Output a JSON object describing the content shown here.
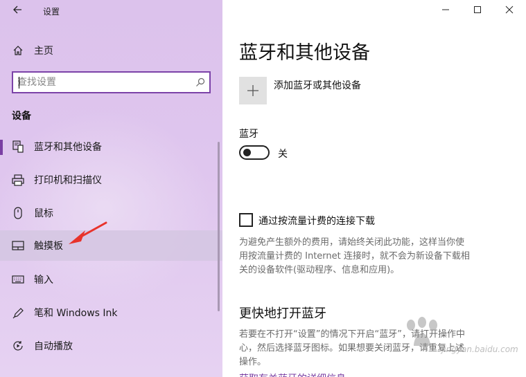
{
  "window": {
    "app_title": "设置",
    "controls": {
      "minimize": "—",
      "maximize": "☐",
      "close": "✕"
    }
  },
  "nav": {
    "home_label": "主页",
    "search_placeholder": "查找设置",
    "section_title": "设备",
    "items": [
      {
        "label": "蓝牙和其他设备",
        "icon": "bluetooth-device-icon",
        "active": true
      },
      {
        "label": "打印机和扫描仪",
        "icon": "printer-icon"
      },
      {
        "label": "鼠标",
        "icon": "mouse-icon"
      },
      {
        "label": "触摸板",
        "icon": "touchpad-icon",
        "hover": true
      },
      {
        "label": "输入",
        "icon": "keyboard-icon"
      },
      {
        "label": "笔和 Windows Ink",
        "icon": "pen-icon"
      },
      {
        "label": "自动播放",
        "icon": "autoplay-icon"
      }
    ]
  },
  "content": {
    "title": "蓝牙和其他设备",
    "add_device_label": "添加蓝牙或其他设备",
    "bluetooth": {
      "heading": "蓝牙",
      "state_label": "关",
      "on": false
    },
    "metered": {
      "label": "通过按流量计费的连接下载",
      "checked": false,
      "description_lines": [
        "为避免产生额外的费用，请始终关闭此功能，这样当你使",
        "用按流量计费的 Internet 连接时，就不会为新设备下载相",
        "关的设备软件(驱动程序、信息和应用)。"
      ]
    },
    "quick": {
      "heading": "更快地打开蓝牙",
      "description_lines": [
        "若要在不打开“设置”的情况下开启“蓝牙”，请打开操作中",
        "心，然后选择蓝牙图标。如果想要关闭蓝牙，请重复上述",
        "操作。"
      ],
      "link_partial": "获取有关蓝牙的详细信息"
    }
  },
  "watermark": "jingyan.baidu.com",
  "colors": {
    "accent": "#7a3fa3",
    "nav_bg": "#dfc6ee",
    "hover_bg": "#d5c7e2",
    "annotation_arrow": "#e8332b"
  }
}
